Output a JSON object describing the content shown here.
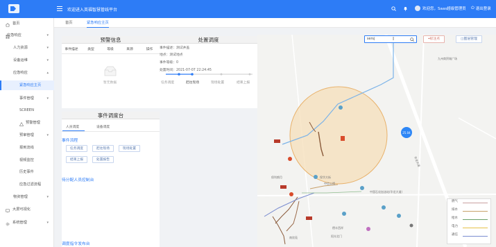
{
  "header": {
    "title": "欢迎进入英福智慧管线平台",
    "user": "欢迎您，Saas超级管理员",
    "logout": "退出登录"
  },
  "sidebar": {
    "items": [
      {
        "label": "首页"
      },
      {
        "label": "应急响应"
      },
      {
        "label": "人力资源"
      },
      {
        "label": "设备运维"
      },
      {
        "label": "应急响应"
      },
      {
        "label": "紧急响应主页"
      },
      {
        "label": "事件管理"
      },
      {
        "label": "SCREEN"
      },
      {
        "label": "预警管理"
      },
      {
        "label": "预审管理"
      },
      {
        "label": "报到流线"
      },
      {
        "label": "视频监控"
      },
      {
        "label": "历史事件"
      },
      {
        "label": "应急过滤流程"
      },
      {
        "label": "物资管理"
      },
      {
        "label": "大屏可视化"
      },
      {
        "label": "系统管理"
      }
    ]
  },
  "tabs": [
    {
      "label": "首页"
    },
    {
      "label": "紧急响应主页"
    }
  ],
  "warning_panel": {
    "title": "预警信息",
    "columns": [
      "事件描述",
      "类型",
      "等级",
      "来源",
      "操作"
    ],
    "empty_text": "暂无数据"
  },
  "dispatch_panel": {
    "title": "处置调度",
    "fields": [
      {
        "label": "事件描述：测试井盖"
      },
      {
        "label": "地点：测试地点"
      },
      {
        "label": "事件等级：0"
      },
      {
        "label": "处置时间：2021-07-07 22:24:45"
      }
    ],
    "steps": [
      "任务调度",
      "赶往现场",
      "现场处置",
      "结束上报"
    ]
  },
  "console_panel": {
    "title": "事件调度台",
    "tabs": [
      "人员调度",
      "设备调度"
    ],
    "flow_title": "事件流程",
    "buttons": [
      "任务调度",
      "赶往现场",
      "现场处置",
      "结束上报",
      "处置报告"
    ],
    "pending": "待分配人员控制台",
    "dispatch_cmd": "调度指令发布台"
  },
  "map": {
    "search_value": "sersj",
    "btn_mark": "标注点",
    "btn_layer": "图层管理",
    "labels": [
      "九州商贸城广场",
      "保华大街",
      "中信公馆",
      "保利朗月",
      "中国石化加油站(华龙大道)",
      "德丰西岸",
      "阳光北门",
      "南欣苑",
      "华龙大道"
    ],
    "blue_badge": "25.04",
    "legend": [
      {
        "label": "燃气",
        "color": "#c9a0a0"
      },
      {
        "label": "排水",
        "color": "#c8a06a"
      },
      {
        "label": "给水",
        "color": "#6aa06a"
      },
      {
        "label": "电力",
        "color": "#e6c247"
      },
      {
        "label": "通信",
        "color": "#7a8cd0"
      }
    ]
  }
}
